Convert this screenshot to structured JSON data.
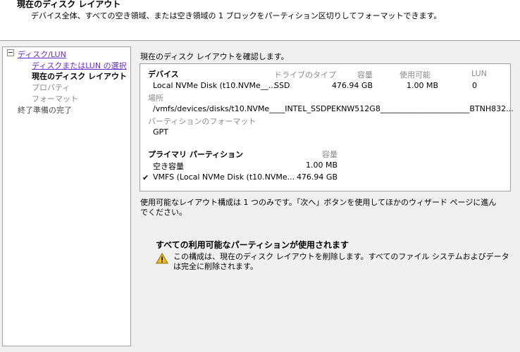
{
  "header": {
    "title": "現在のディスク レイアウト",
    "description": "デバイス全体、すべての空き領域、または空き領域の 1 ブロックをパーティション区切りしてフォーマットできます。"
  },
  "nav": {
    "group": "ディスク/LUN",
    "items": [
      {
        "label": "ディスクまたはLUN の選択",
        "state": "link"
      },
      {
        "label": "現在のディスク レイアウト",
        "state": "current"
      },
      {
        "label": "プロパティ",
        "state": "disabled"
      },
      {
        "label": "フォーマット",
        "state": "disabled"
      }
    ],
    "finish": "終了準備の完了"
  },
  "main": {
    "intro": "現在のディスク レイアウトを確認します。",
    "device": {
      "section_label": "デバイス",
      "columns": {
        "drive_type": "ドライブのタイプ",
        "capacity": "容量",
        "available": "使用可能",
        "lun": "LUN"
      },
      "name": "Local NVMe Disk (t10.NVMe__...",
      "drive_type": "SSD",
      "capacity": "476.94 GB",
      "available": "1.00 MB",
      "lun": "0",
      "location_label": "場所",
      "location": "/vmfs/devices/disks/t10.NVMe____INTEL_SSDPEKNW512G8_______________________BTNH832...",
      "partition_format_label": "パーティションのフォーマット",
      "partition_format": "GPT"
    },
    "primary": {
      "section_label": "プライマリ パーティション",
      "capacity_header": "容量",
      "rows": [
        {
          "name": "空き容量",
          "capacity": "1.00 MB",
          "checked": false
        },
        {
          "name": "VMFS (Local NVMe Disk (t10.NVMe...",
          "capacity": "476.94 GB",
          "checked": true
        }
      ]
    },
    "summary": "使用可能なレイアウト構成は 1 つのみです。「次へ」ボタンを使用してほかのウィザード ページに進んでください。",
    "warning": {
      "title": "すべての利用可能なパーティションが使用されます",
      "text": "この構成は、現在のディスク レイアウトを削除します。すべてのファイル システムおよびデータは完全に削除されます。",
      "icon": "warning-icon",
      "icon_color": "#f0c020"
    }
  }
}
